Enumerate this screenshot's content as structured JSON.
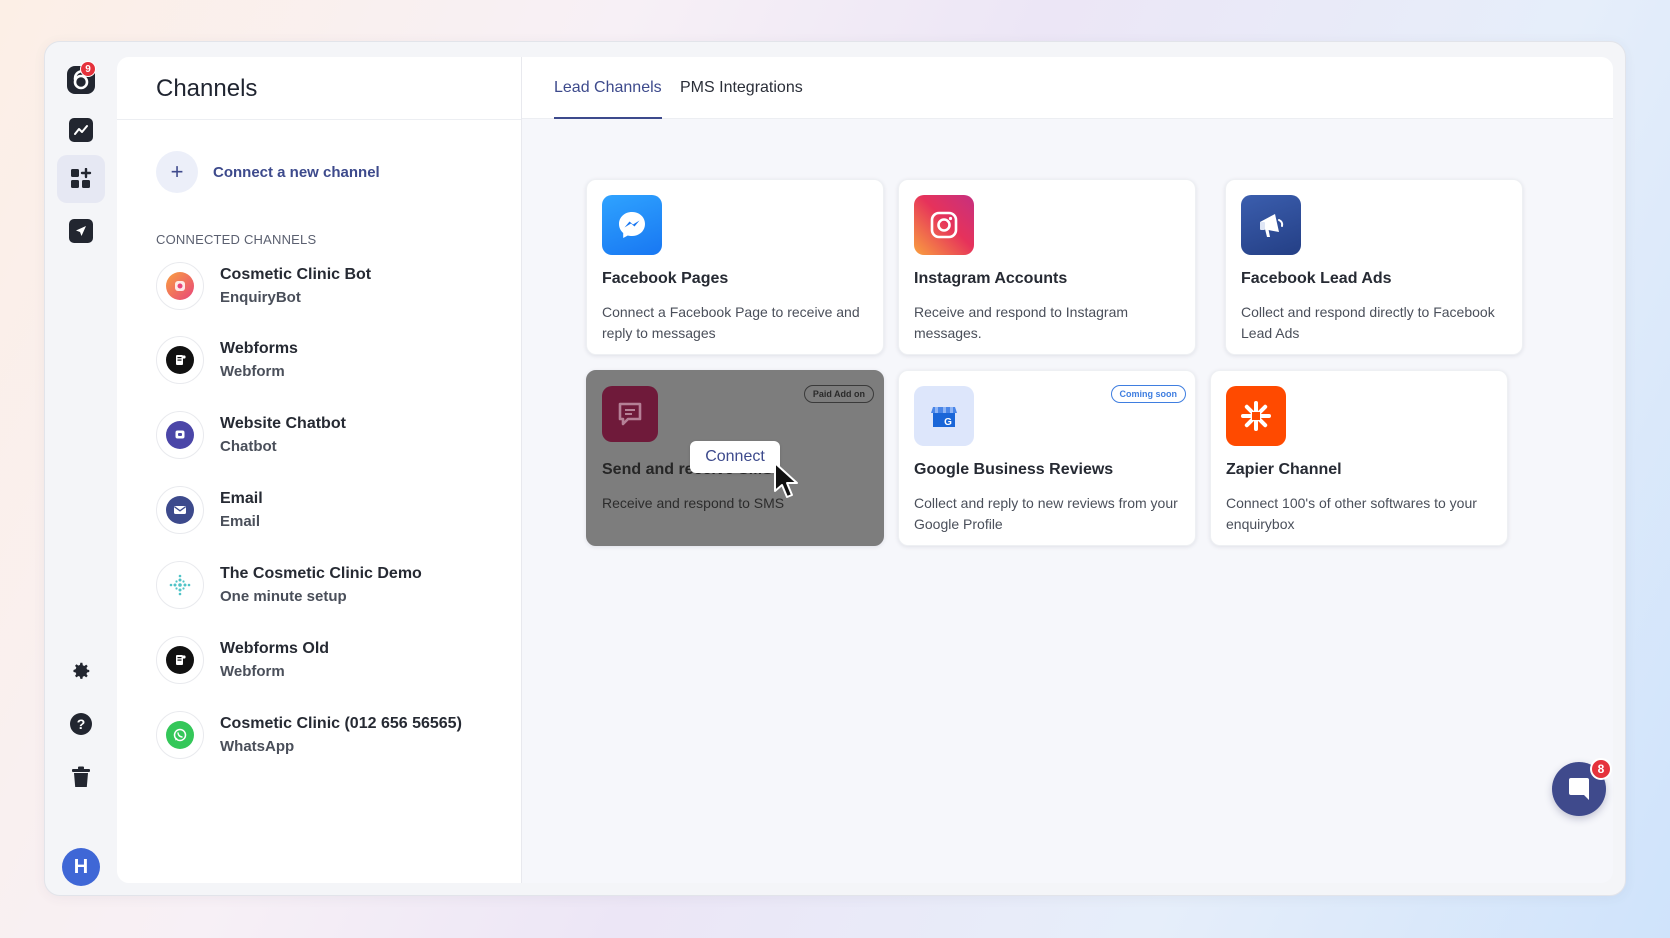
{
  "rail": {
    "logo_badge": "9",
    "avatar_initial": "H",
    "items": [
      {
        "name": "analytics"
      },
      {
        "name": "channels"
      },
      {
        "name": "campaigns"
      },
      {
        "name": "settings"
      },
      {
        "name": "help"
      },
      {
        "name": "trash"
      }
    ]
  },
  "channels_panel": {
    "title": "Channels",
    "connect_new_label": "Connect a new channel",
    "section_label": "CONNECTED CHANNELS",
    "items": [
      {
        "name": "Cosmetic Clinic Bot",
        "type": "EnquiryBot",
        "icon": "enquirybot-icon"
      },
      {
        "name": "Webforms",
        "type": "Webform",
        "icon": "webform-icon"
      },
      {
        "name": "Website Chatbot",
        "type": "Chatbot",
        "icon": "chatbot-icon"
      },
      {
        "name": "Email",
        "type": "Email",
        "icon": "email-icon"
      },
      {
        "name": "The Cosmetic Clinic Demo",
        "type": "One minute setup",
        "icon": "sparkle-icon"
      },
      {
        "name": "Webforms Old",
        "type": "Webform",
        "icon": "webform-icon"
      },
      {
        "name": "Cosmetic Clinic (012 656 56565)",
        "type": "WhatsApp",
        "icon": "whatsapp-icon"
      }
    ]
  },
  "tabs": {
    "lead_channels": "Lead Channels",
    "pms_integrations": "PMS Integrations"
  },
  "cards": [
    {
      "title": "Facebook Pages",
      "desc": "Connect a Facebook Page to receive and reply to messages"
    },
    {
      "title": "Instagram Accounts",
      "desc": "Receive and respond to Instagram messages."
    },
    {
      "title": "Facebook Lead Ads",
      "desc": "Collect and respond directly to Facebook Lead Ads"
    },
    {
      "title": "Send and receive SMS",
      "desc": "Receive and respond to SMS",
      "badge": "Paid Add on",
      "hover_action": "Connect"
    },
    {
      "title": "Google Business Reviews",
      "desc": "Collect and reply to new reviews from your Google Profile",
      "badge": "Coming soon"
    },
    {
      "title": "Zapier Channel",
      "desc": "Connect 100's of other softwares to your enquirybox"
    }
  ],
  "chat_widget": {
    "badge": "8"
  },
  "colors": {
    "accent": "#3d4a8c",
    "facebook": "#1877f2",
    "zapier": "#ff4a00",
    "sms": "#6f1a3a",
    "badge_red": "#e5323c"
  }
}
